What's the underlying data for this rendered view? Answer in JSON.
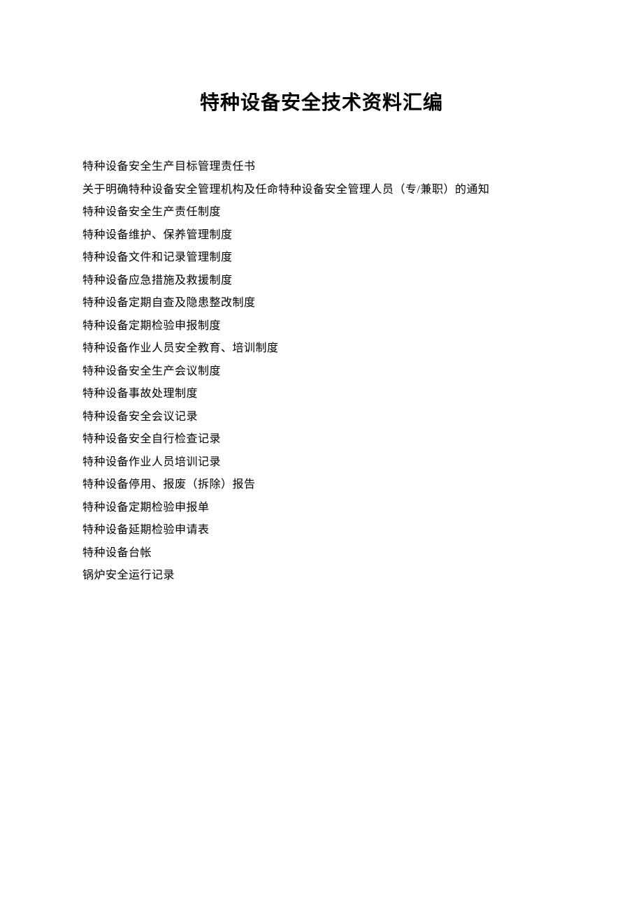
{
  "title": "特种设备安全技术资料汇编",
  "items": [
    "特种设备安全生产目标管理责任书",
    "关于明确特种设备安全管理机构及任命特种设备安全管理人员（专/兼职）的通知",
    "特种设备安全生产责任制度",
    "特种设备维护、保养管理制度",
    "特种设备文件和记录管理制度",
    "特种设备应急措施及救援制度",
    "特种设备定期自查及隐患整改制度",
    "特种设备定期检验申报制度",
    "特种设备作业人员安全教育、培训制度",
    "特种设备安全生产会议制度",
    "特种设备事故处理制度",
    "特种设备安全会议记录",
    "特种设备安全自行检查记录",
    "特种设备作业人员培训记录",
    "特种设备停用、报废（拆除）报告",
    "特种设备定期检验申报单",
    "特种设备延期检验申请表",
    "特种设备台帐",
    "锅炉安全运行记录"
  ]
}
